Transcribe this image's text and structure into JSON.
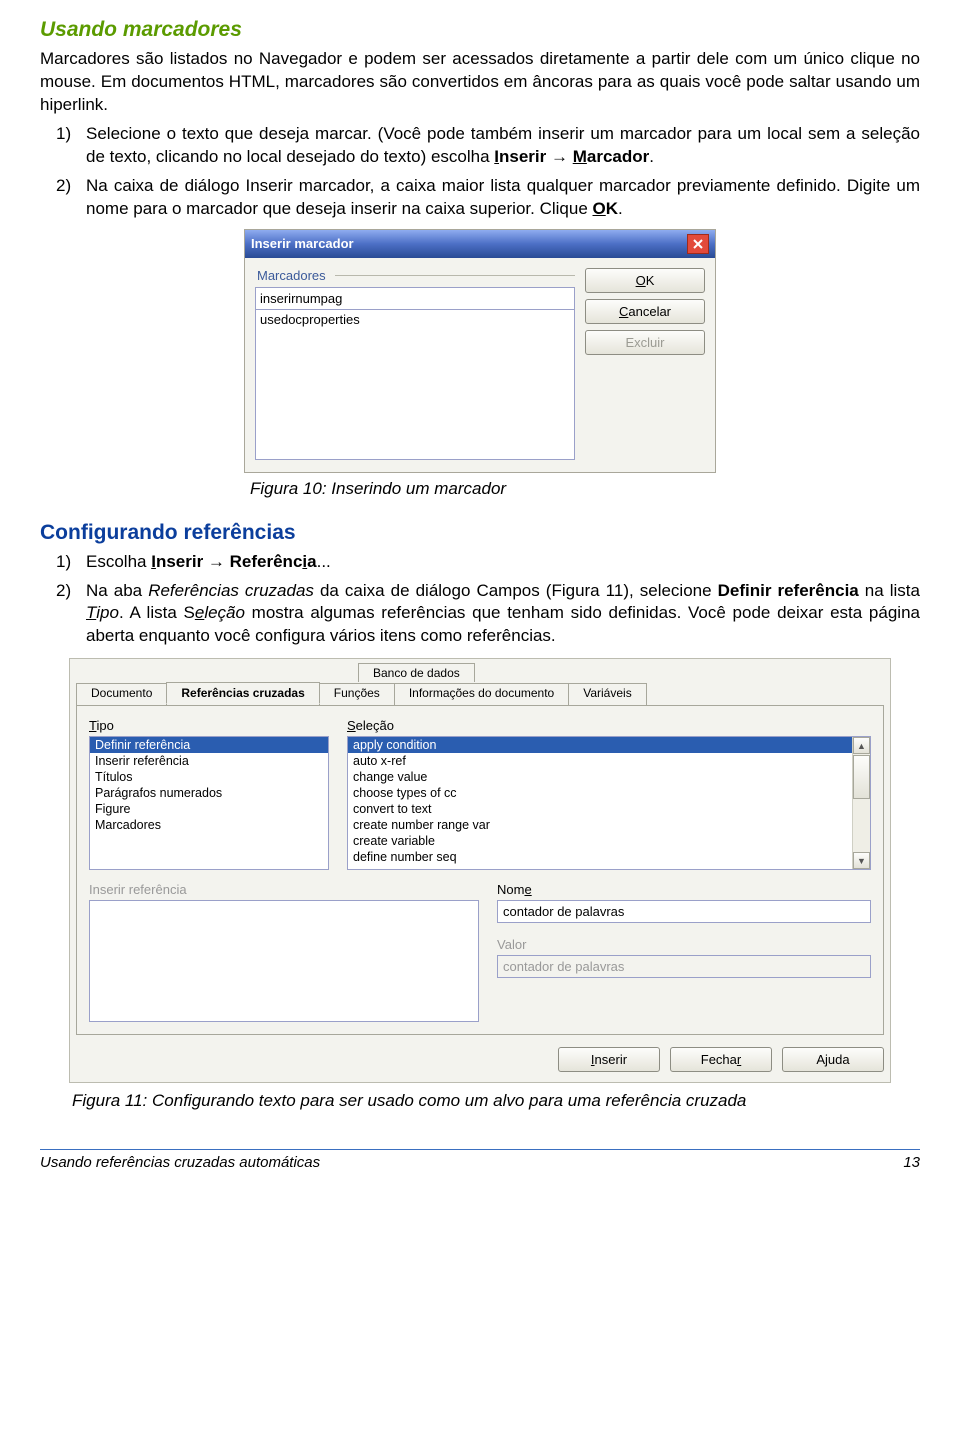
{
  "heading1": "Usando marcadores",
  "para1": "Marcadores são listados no Navegador e podem ser acessados diretamente a partir dele com um único clique no mouse. Em documentos HTML, marcadores são convertidos em âncoras para as quais você pode saltar usando um hiperlink.",
  "list1": {
    "i1n": "1)",
    "i1a": "Selecione o texto que deseja marcar. (Você pode também inserir um marcador para um local sem a seleção de texto, clicando no local desejado do texto) escolha ",
    "i1b_u1": "I",
    "i1b_t1": "nserir → ",
    "i1b_u2": "M",
    "i1b_t2": "arcador",
    "i1b_t3": ".",
    "i2n": "2)",
    "i2a": "Na caixa de diálogo Inserir marcador, a caixa maior lista qualquer marcador previamente definido. Digite um nome para o marcador que deseja inserir na caixa superior. Clique ",
    "i2b_u": "O",
    "i2b_t": "K",
    "i2b_t2": "."
  },
  "dlg1": {
    "title": "Inserir marcador",
    "fieldset": "Marcadores",
    "input": "inserirnumpag",
    "listitem": "usedocproperties",
    "ok_u": "O",
    "ok_t": "K",
    "cancel_u": "C",
    "cancel_t": "ancelar",
    "delete_u": "E",
    "delete_t": "xcluir"
  },
  "fig1": "Figura 10: Inserindo um marcador",
  "heading2": "Configurando referências",
  "list2": {
    "i1n": "1)",
    "i1a": "Escolha ",
    "i1_u1": "I",
    "i1_t1": "nserir",
    "i1_t1b": " → ",
    "i1_t2": "Referênc",
    "i1_u2": "i",
    "i1_t3": "a",
    "i1_t4": "...",
    "i2n": "2)",
    "i2a": "Na aba ",
    "i2_it1": "Referências cruzadas",
    "i2b": " da caixa de diálogo Campos (Figura 11), selecione ",
    "i2_b1": "Definir referência",
    "i2c": " na lista ",
    "i2_it2a": "T",
    "i2_it2b": "ipo",
    "i2d": ". A lista S",
    "i2_u": "e",
    "i2e": "leção",
    " i2e2": "",
    "i2f": " mostra algumas referências que tenham sido definidas. Você pode deixar esta página aberta enquanto você configura vários itens como referências."
  },
  "dlg2": {
    "tabs_top": {
      "banco": "Banco de dados"
    },
    "tabs": {
      "doc": "Documento",
      "ref": "Referências cruzadas",
      "func": "Funções",
      "info": "Informações do documento",
      "var": "Variáveis"
    },
    "tipo_label": "Tipo",
    "tipo_u": "T",
    "selecao_label": "eleção",
    "selecao_u": "S",
    "tipo_items": [
      "Definir referência",
      "Inserir referência",
      "Títulos",
      "Parágrafos numerados",
      "Figure",
      "Marcadores"
    ],
    "selecao_items": [
      "apply condition",
      "auto x-ref",
      "change value",
      "choose types of cc",
      "convert to text",
      "create number range var",
      "create variable",
      "define number seq"
    ],
    "insref": "eferência",
    "insref_pre": "Inserir ",
    "insref_u": "r",
    "nome": "e",
    "nome_pre": "Nom",
    "nome_val": "contador de palavras",
    "valor": "alor",
    "valor_u": "V",
    "valor_val": "contador de palavras",
    "btn_ins": "nserir",
    "btn_ins_u": "I",
    "btn_close": "r",
    "btn_close_pre": "Fecha",
    "btn_help": "uda",
    "btn_help_pre": "Aj",
    "btn_help_u": ""
  },
  "fig2": "Figura 11: Configurando texto para ser usado como um alvo para uma referência cruzada",
  "footer": {
    "left": "Usando referências cruzadas automáticas",
    "right": "13"
  }
}
